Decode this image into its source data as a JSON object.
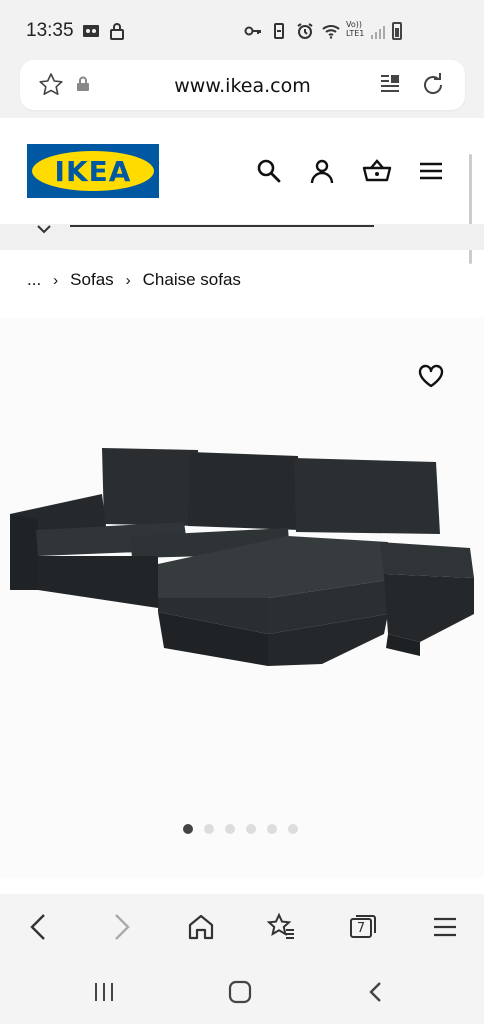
{
  "status": {
    "time": "13:35",
    "volte_top": "Vo))",
    "volte_bottom": "LTE1"
  },
  "browser": {
    "url": "www.ikea.com",
    "tabs_count": "7"
  },
  "header": {
    "logo_text": "IKEA",
    "brand_colors": {
      "blue": "#0058a3",
      "yellow": "#ffdb00"
    }
  },
  "breadcrumb": {
    "ellipsis": "...",
    "items": [
      "Sofas",
      "Chaise sofas"
    ]
  },
  "carousel": {
    "total_dots": 6,
    "active_index": 0
  },
  "icons": {
    "search": "search-icon",
    "profile": "profile-icon",
    "cart": "shopping-basket-icon",
    "menu": "hamburger-menu-icon",
    "favorite": "heart-icon"
  }
}
